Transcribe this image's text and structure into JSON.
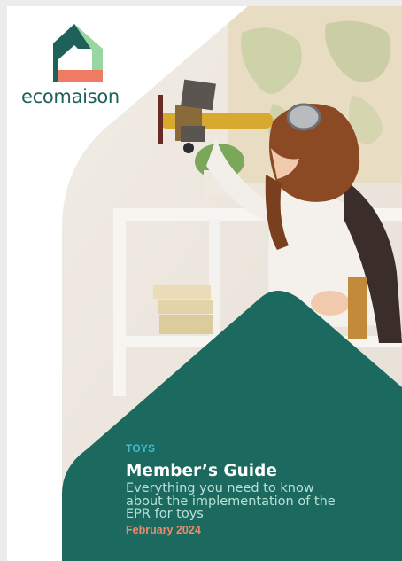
{
  "brand": {
    "name": "ecomaison",
    "colors": {
      "dark_green": "#1d6158",
      "light_green": "#9ad6a1",
      "coral": "#ef7b62"
    }
  },
  "cover": {
    "category": "TOYS",
    "title": "Member’s Guide",
    "subtitle": "Everything you need to know about the implementation of the EPR for toys",
    "date": "February 2024",
    "accent_teal": "#1c6a5f",
    "photo_description_icon": "child-with-toy-airplane-photo"
  }
}
